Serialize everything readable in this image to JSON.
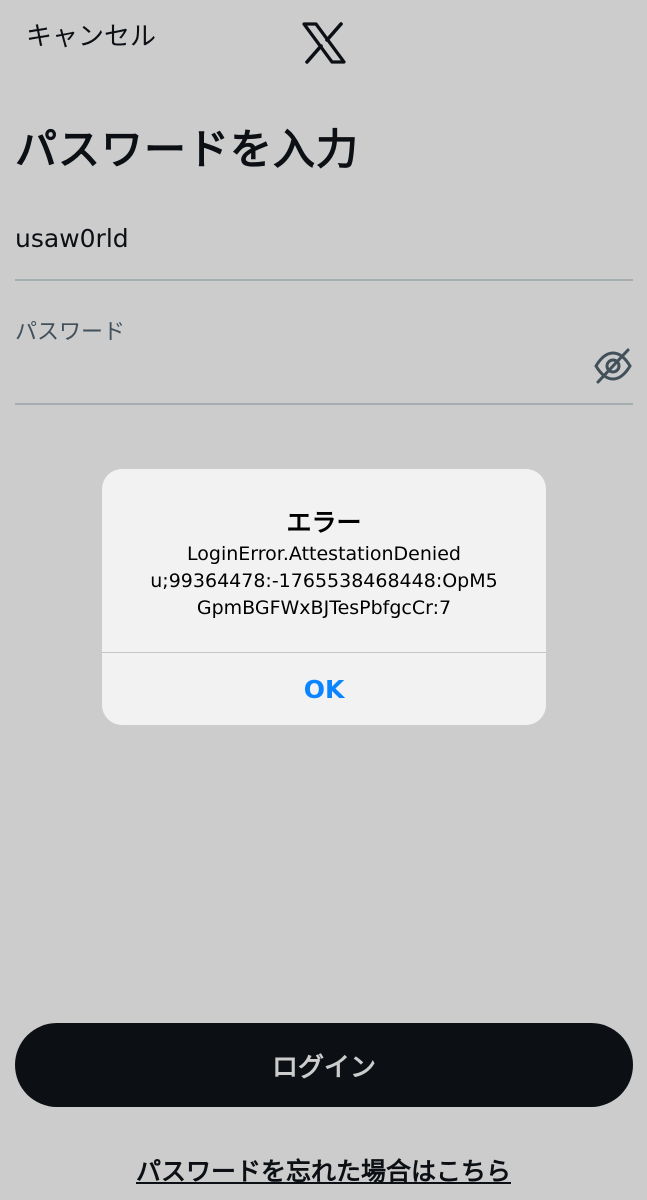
{
  "header": {
    "cancel_label": "キャンセル",
    "logo_icon": "x-logo-icon"
  },
  "form": {
    "title": "パスワードを入力",
    "username_value": "usaw0rld",
    "password_label": "パスワード",
    "password_value": "",
    "visibility_icon": "eye-slash-icon"
  },
  "footer": {
    "login_label": "ログイン",
    "forgot_label": "パスワードを忘れた場合はこちら"
  },
  "alert": {
    "title": "エラー",
    "message_lines": [
      "LoginError.AttestationDenied",
      "u;99364478:-1765538468448:OpM5",
      "GpmBGFWxBJTesPbfgcCr:7"
    ],
    "ok_label": "OK"
  },
  "colors": {
    "ok_blue": "#0a84ff",
    "button_dark": "#0f1419",
    "divider": "#cfd9de"
  }
}
